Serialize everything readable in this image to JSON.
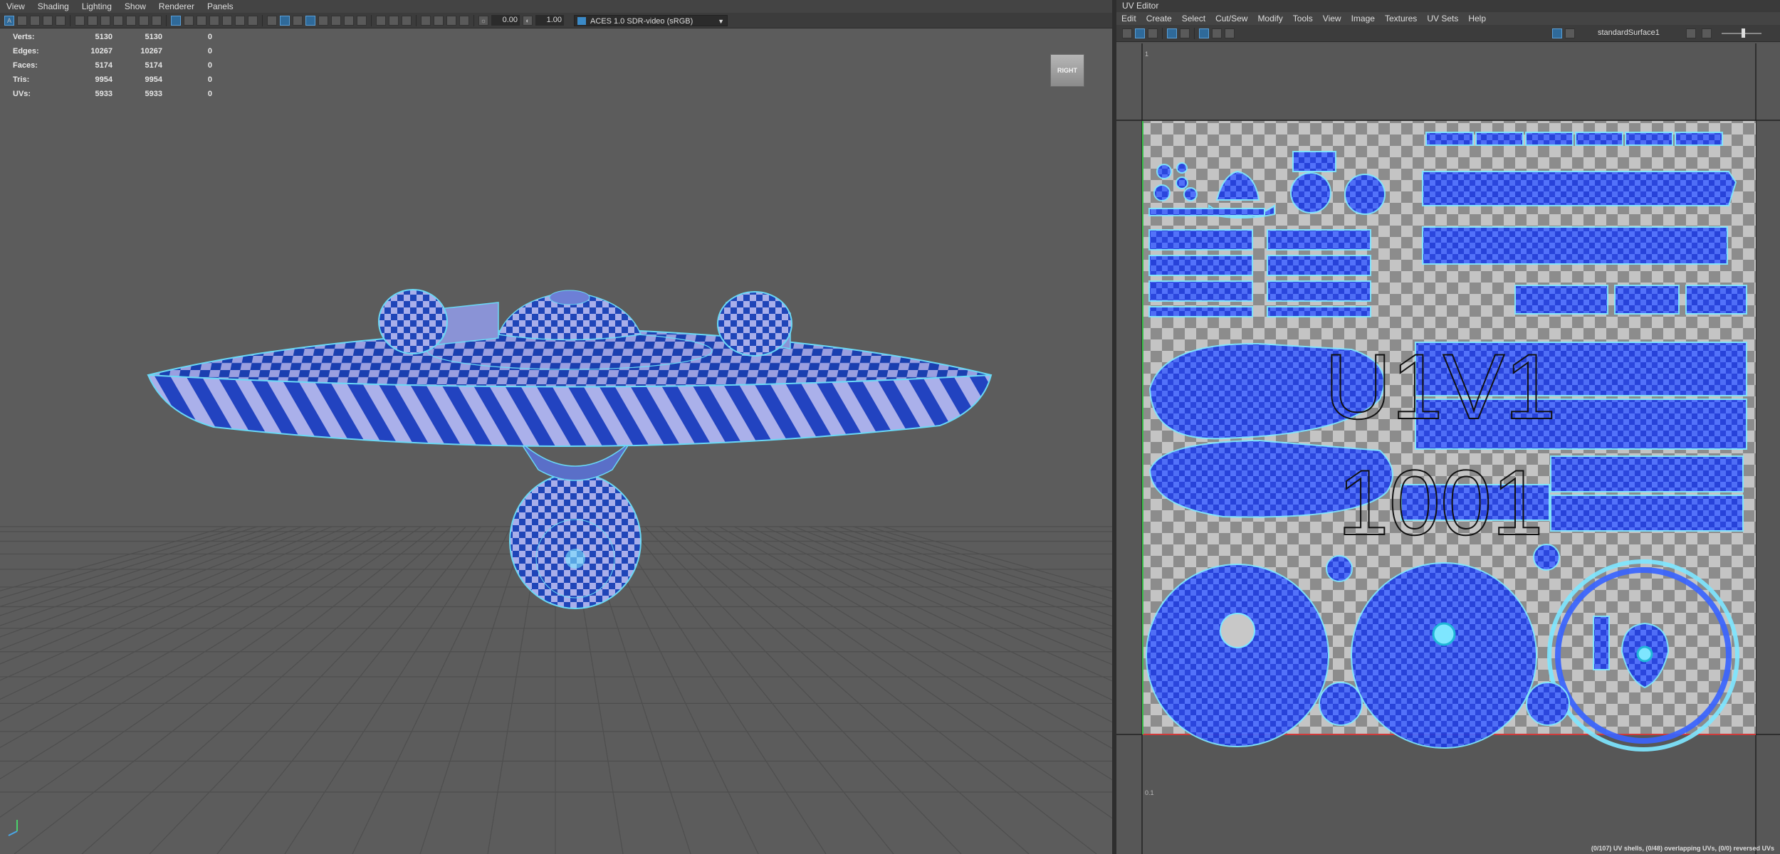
{
  "viewport": {
    "menu": [
      "View",
      "Shading",
      "Lighting",
      "Show",
      "Renderer",
      "Panels"
    ],
    "toolbar": {
      "field1": "0.00",
      "field2": "1.00",
      "color_space": "ACES 1.0 SDR-video (sRGB)"
    },
    "hud": [
      {
        "label": "Verts:",
        "v1": "5130",
        "v2": "5130",
        "v3": "0"
      },
      {
        "label": "Edges:",
        "v1": "10267",
        "v2": "10267",
        "v3": "0"
      },
      {
        "label": "Faces:",
        "v1": "5174",
        "v2": "5174",
        "v3": "0"
      },
      {
        "label": "Tris:",
        "v1": "9954",
        "v2": "9954",
        "v3": "0"
      },
      {
        "label": "UVs:",
        "v1": "5933",
        "v2": "5933",
        "v3": "0"
      }
    ],
    "view_cube_label": "RIGHT",
    "colors": {
      "background": "#5c5c5c",
      "mesh_dark": "#1a3fb0",
      "mesh_light": "#9a9fe0",
      "wireframe": "#6ad8f5"
    }
  },
  "uv_editor": {
    "title": "UV Editor",
    "menu": [
      "Edit",
      "Create",
      "Select",
      "Cut/Sew",
      "Modify",
      "Tools",
      "View",
      "Image",
      "Textures",
      "UV Sets",
      "Help"
    ],
    "shader_label": "standardSurface1",
    "tile_label_1": "U1V1",
    "tile_label_2": "1001",
    "axis_top": "1",
    "axis_bottom": "0.1",
    "status": "(0/107) UV shells, (0/48) overlapping UVs, (0/0) reversed UVs",
    "colors": {
      "shell_fill": "#2a4dff",
      "shell_edge": "#7ee6ff",
      "checker_light": "#c8c8c8",
      "checker_dark": "#8c8c8c"
    }
  }
}
